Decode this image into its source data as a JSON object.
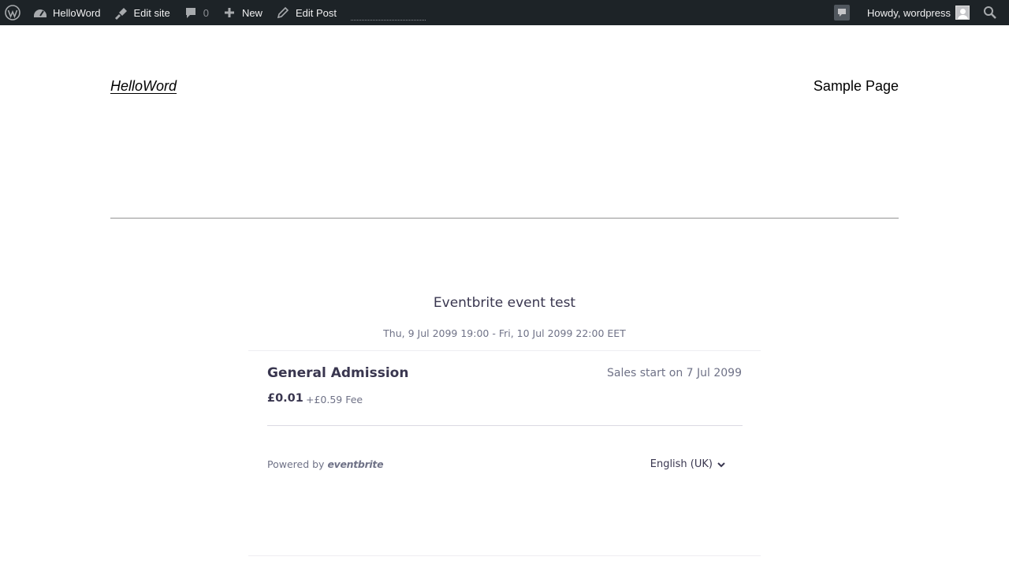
{
  "adminbar": {
    "site_name": "HelloWord",
    "edit_site": "Edit site",
    "comments_count": "0",
    "new_label": "New",
    "edit_post": "Edit Post",
    "howdy": "Howdy, wordpress",
    "icons": [
      "wordpress-logo-icon",
      "dashboard-icon",
      "brush-icon",
      "comment-icon",
      "plus-icon",
      "pencil-icon",
      "notification-icon",
      "avatar",
      "search-icon"
    ]
  },
  "site": {
    "title": "HelloWord",
    "nav": [
      "Sample Page"
    ]
  },
  "event": {
    "title": "Eventbrite event test",
    "date_range": "Thu, 9 Jul 2099 19:00 - Fri, 10 Jul 2099 22:00 EET",
    "ticket": {
      "name": "General Admission",
      "sales_status": "Sales start on 7 Jul 2099",
      "price": "£0.01",
      "fee": "+£0.59 Fee"
    },
    "footer": {
      "powered_by": "Powered by",
      "brand": "eventbrite",
      "language": "English (UK)"
    }
  },
  "colors": {
    "adminbar_bg": "#1d2327",
    "eb_text": "#39364f",
    "eb_muted": "#6f7287"
  }
}
